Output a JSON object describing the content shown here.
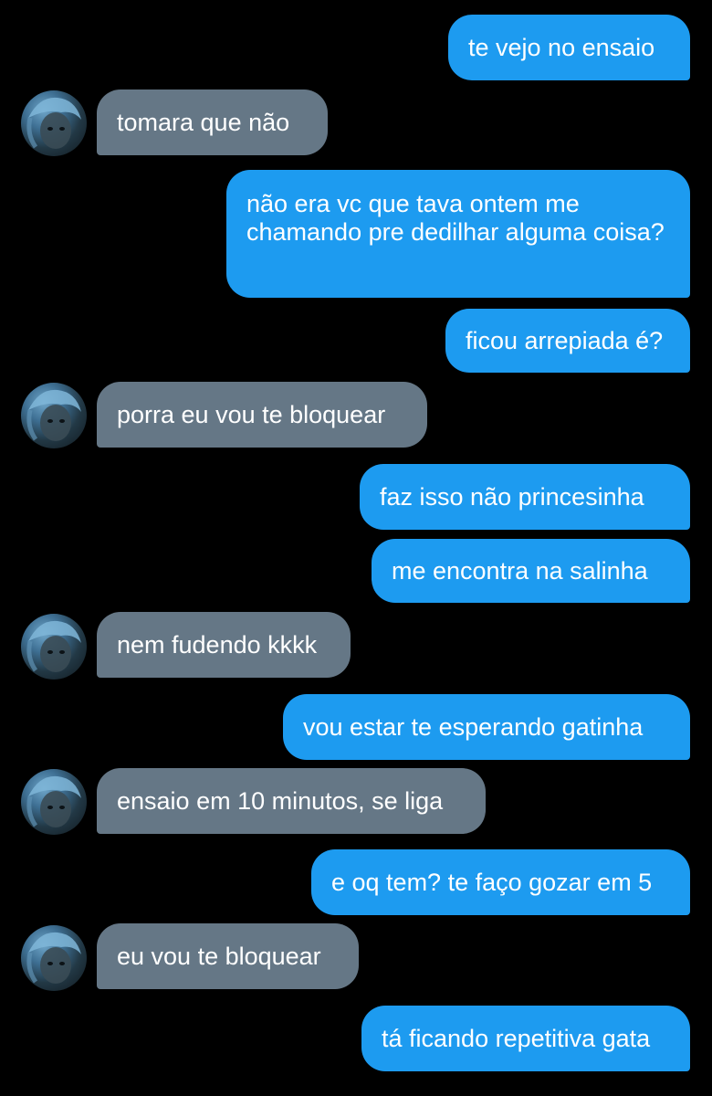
{
  "conversation": {
    "messages": [
      {
        "side": "sent",
        "text": "te vejo no ensaio"
      },
      {
        "side": "received",
        "text": "tomara que não"
      },
      {
        "side": "sent",
        "text": "não era vc que tava ontem me chamando pre dedilhar alguma coisa?"
      },
      {
        "side": "sent",
        "text": "ficou arrepiada é?"
      },
      {
        "side": "received",
        "text": "porra eu vou te bloquear"
      },
      {
        "side": "sent",
        "text": "faz isso não princesinha"
      },
      {
        "side": "sent",
        "text": "me encontra na salinha"
      },
      {
        "side": "received",
        "text": "nem fudendo kkkk"
      },
      {
        "side": "sent",
        "text": "vou estar te esperando gatinha"
      },
      {
        "side": "received",
        "text": "ensaio em 10 minutos, se liga"
      },
      {
        "side": "sent",
        "text": "e oq tem? te faço gozar em 5"
      },
      {
        "side": "received",
        "text": "eu vou te bloquear"
      },
      {
        "side": "sent",
        "text": "tá ficando repetitiva gata"
      }
    ]
  },
  "colors": {
    "background": "#000000",
    "sent_bubble": "#1d9bf0",
    "received_bubble": "#657786",
    "text": "#ffffff"
  },
  "icons": {
    "avatar": "contact-avatar-photo"
  }
}
